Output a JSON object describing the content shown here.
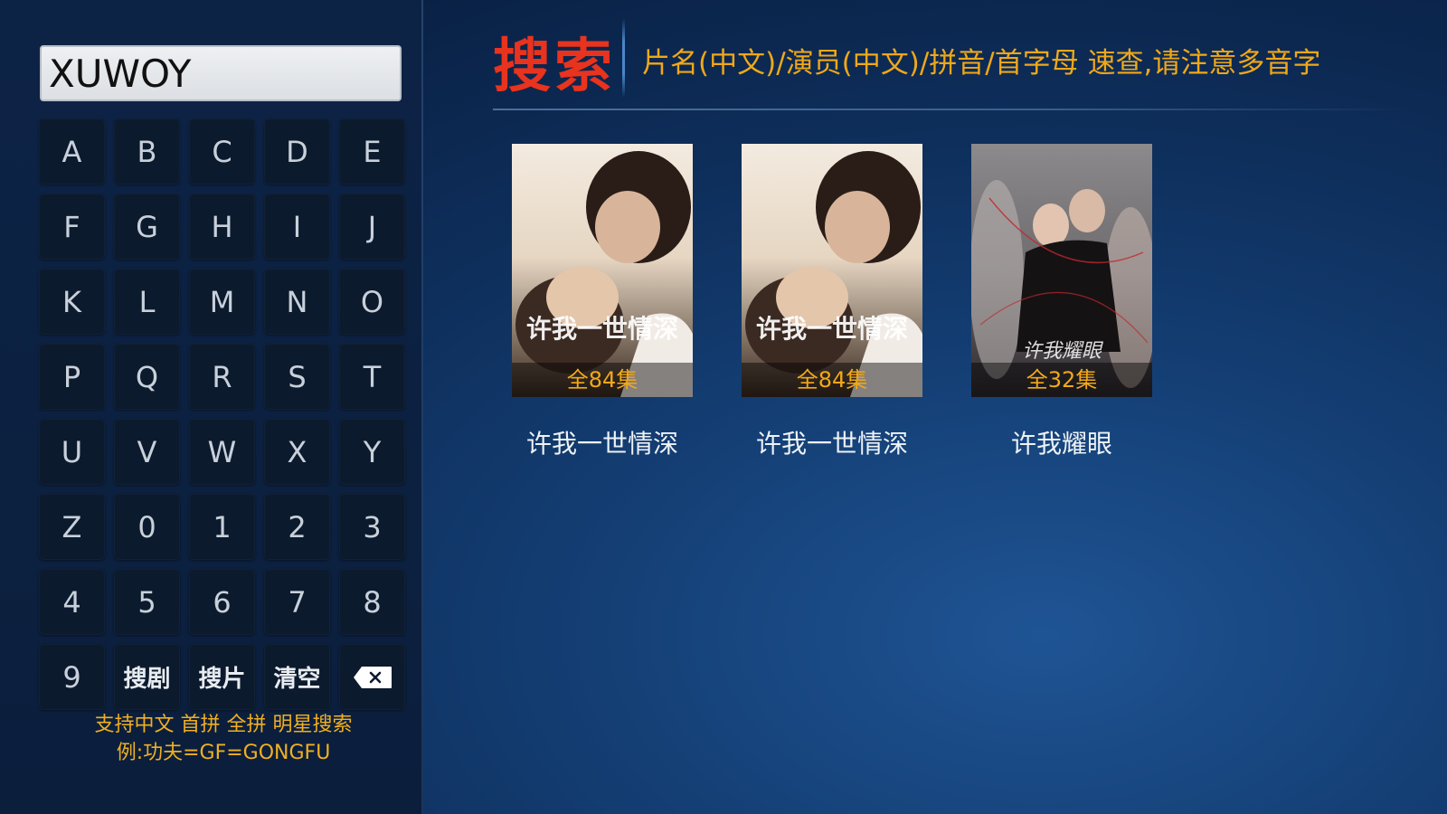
{
  "search": {
    "input_value": "XUWOY",
    "title": "搜索",
    "hint": "片名(中文)/演员(中文)/拼音/首字母 速查,请注意多音字"
  },
  "keyboard": {
    "keys": [
      "A",
      "B",
      "C",
      "D",
      "E",
      "F",
      "G",
      "H",
      "I",
      "J",
      "K",
      "L",
      "M",
      "N",
      "O",
      "P",
      "Q",
      "R",
      "S",
      "T",
      "U",
      "V",
      "W",
      "X",
      "Y",
      "Z",
      "0",
      "1",
      "2",
      "3",
      "4",
      "5",
      "6",
      "7",
      "8",
      "9"
    ],
    "search_series_label": "搜剧",
    "search_movie_label": "搜片",
    "clear_label": "清空",
    "backspace_icon": "backspace-icon"
  },
  "help": {
    "line1": "支持中文 首拼 全拼 明星搜索",
    "line2": "例:功夫=GF=GONGFU"
  },
  "colors": {
    "title_red": "#e8331e",
    "hint_orange": "#f0a818",
    "episode_orange": "#f2a81a"
  },
  "results": [
    {
      "title": "许我一世情深",
      "episodes": "全84集",
      "poster_text": "许我一世情深"
    },
    {
      "title": "许我一世情深",
      "episodes": "全84集",
      "poster_text": "许我一世情深"
    },
    {
      "title": "许我耀眼",
      "episodes": "全32集",
      "poster_text": "许我耀眼"
    }
  ]
}
